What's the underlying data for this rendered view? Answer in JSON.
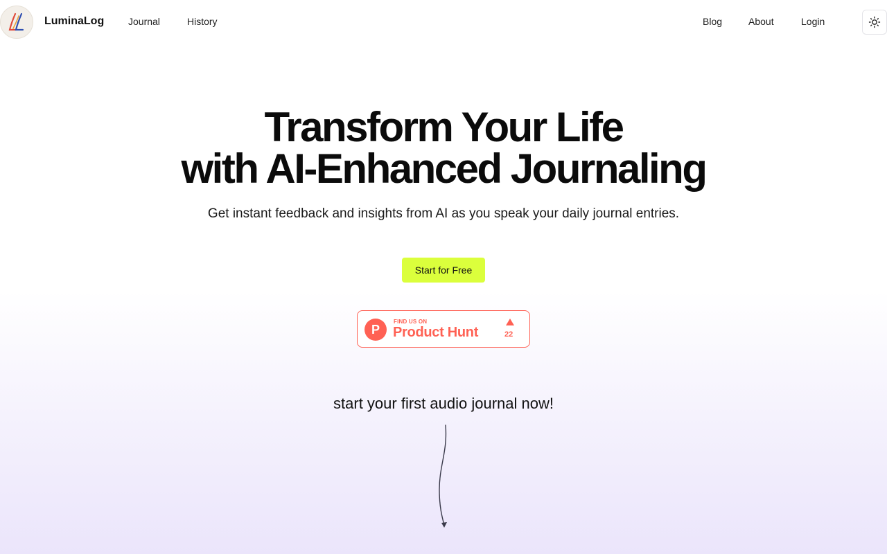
{
  "header": {
    "brand": "LuminaLog",
    "nav_left": [
      "Journal",
      "History"
    ],
    "nav_right": [
      "Blog",
      "About",
      "Login"
    ],
    "theme_toggle_icon": "sun-icon"
  },
  "hero": {
    "title_line1": "Transform Your Life",
    "title_line2": "with AI-Enhanced Journaling",
    "subtitle": "Get instant feedback and insights from AI as you speak your daily journal entries.",
    "cta_label": "Start for Free"
  },
  "product_hunt": {
    "find_text": "FIND US ON",
    "name": "Product Hunt",
    "logo_letter": "P",
    "upvotes": "22"
  },
  "prompt": {
    "text": "start your first audio journal now!"
  },
  "colors": {
    "cta": "#dbff3c",
    "product_hunt": "#ff6154"
  }
}
